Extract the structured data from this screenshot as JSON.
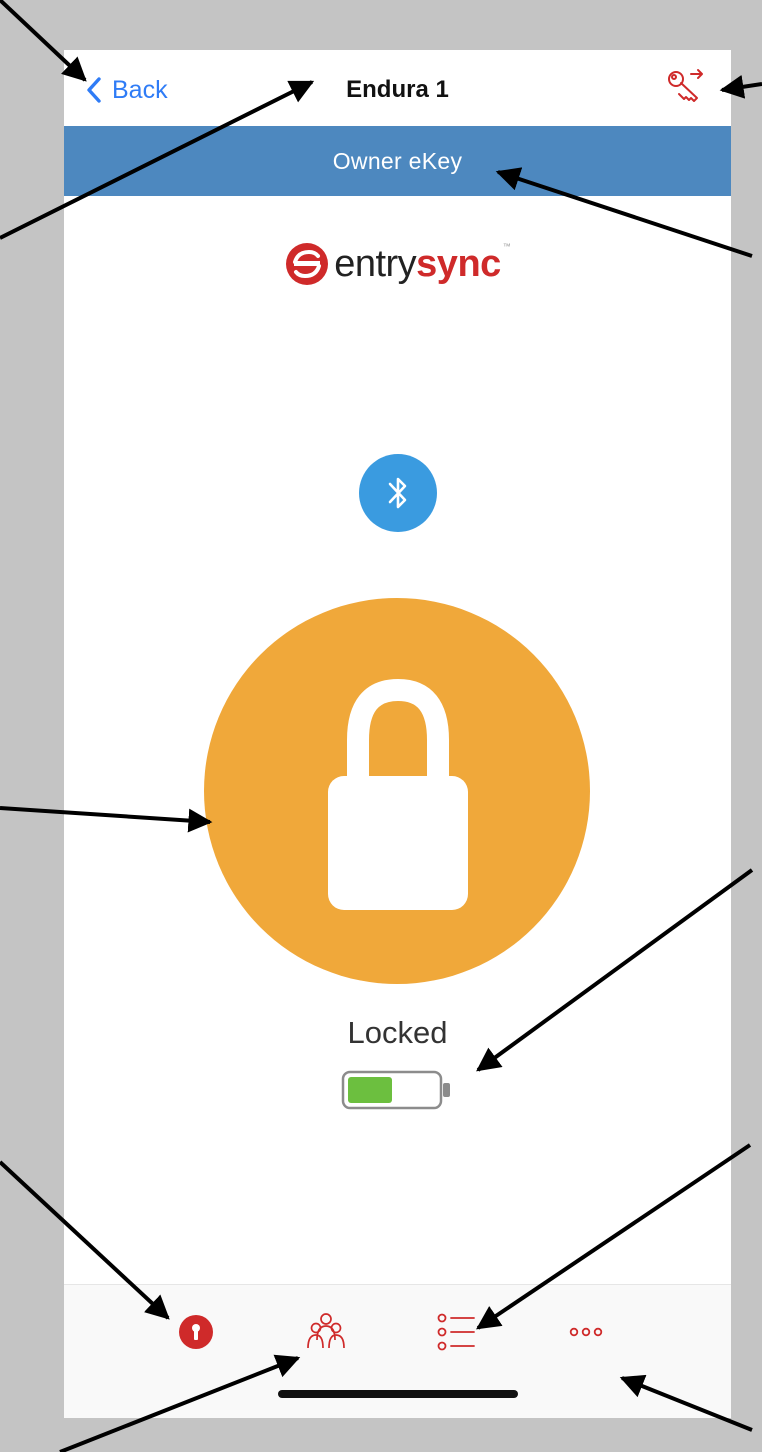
{
  "navbar": {
    "back_label": "Back",
    "title": "Endura 1",
    "back_icon": "chevron-left-icon",
    "share_icon": "share-key-icon"
  },
  "banner": {
    "text": "Owner eKey"
  },
  "brand": {
    "name_part1": "entry",
    "name_part2": "sync",
    "trademark": "™"
  },
  "lock": {
    "status": "Locked",
    "bluetooth_icon": "bluetooth-icon",
    "lock_icon": "padlock-icon",
    "battery_level": 0.5
  },
  "tabs": [
    {
      "icon": "keyhole-icon"
    },
    {
      "icon": "users-icon"
    },
    {
      "icon": "list-icon"
    },
    {
      "icon": "more-icon"
    }
  ],
  "colors": {
    "accent_red": "#cf2a2a",
    "banner_blue": "#4d88bf",
    "lock_orange": "#f0a83a",
    "bluetooth_blue": "#3a9be0",
    "link_blue": "#2f7cf6",
    "battery_green": "#6cbf3f"
  }
}
